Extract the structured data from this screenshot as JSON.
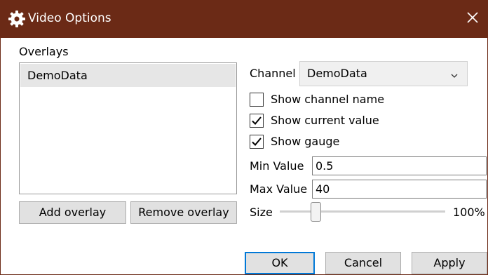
{
  "window": {
    "title": "Video Options",
    "title_icon": "gear-icon",
    "close_icon": "close-icon",
    "titlebar_color": "#6b2a16"
  },
  "overlays": {
    "label": "Overlays",
    "items": [
      {
        "label": "DemoData",
        "selected": true
      }
    ],
    "add_label": "Add overlay",
    "remove_label": "Remove overlay"
  },
  "channel": {
    "label": "Channel",
    "value": "DemoData"
  },
  "options": {
    "show_channel_name": {
      "label": "Show channel name",
      "checked": false
    },
    "show_current_value": {
      "label": "Show current value",
      "checked": true
    },
    "show_gauge": {
      "label": "Show gauge",
      "checked": true
    }
  },
  "min_value": {
    "label": "Min Value",
    "value": "0.5"
  },
  "max_value": {
    "label": "Max Value",
    "value": "40"
  },
  "size": {
    "label": "Size",
    "percent": 100,
    "display": "100%",
    "slider_fraction": 0.2
  },
  "footer": {
    "ok_label": "OK",
    "cancel_label": "Cancel",
    "apply_label": "Apply"
  }
}
